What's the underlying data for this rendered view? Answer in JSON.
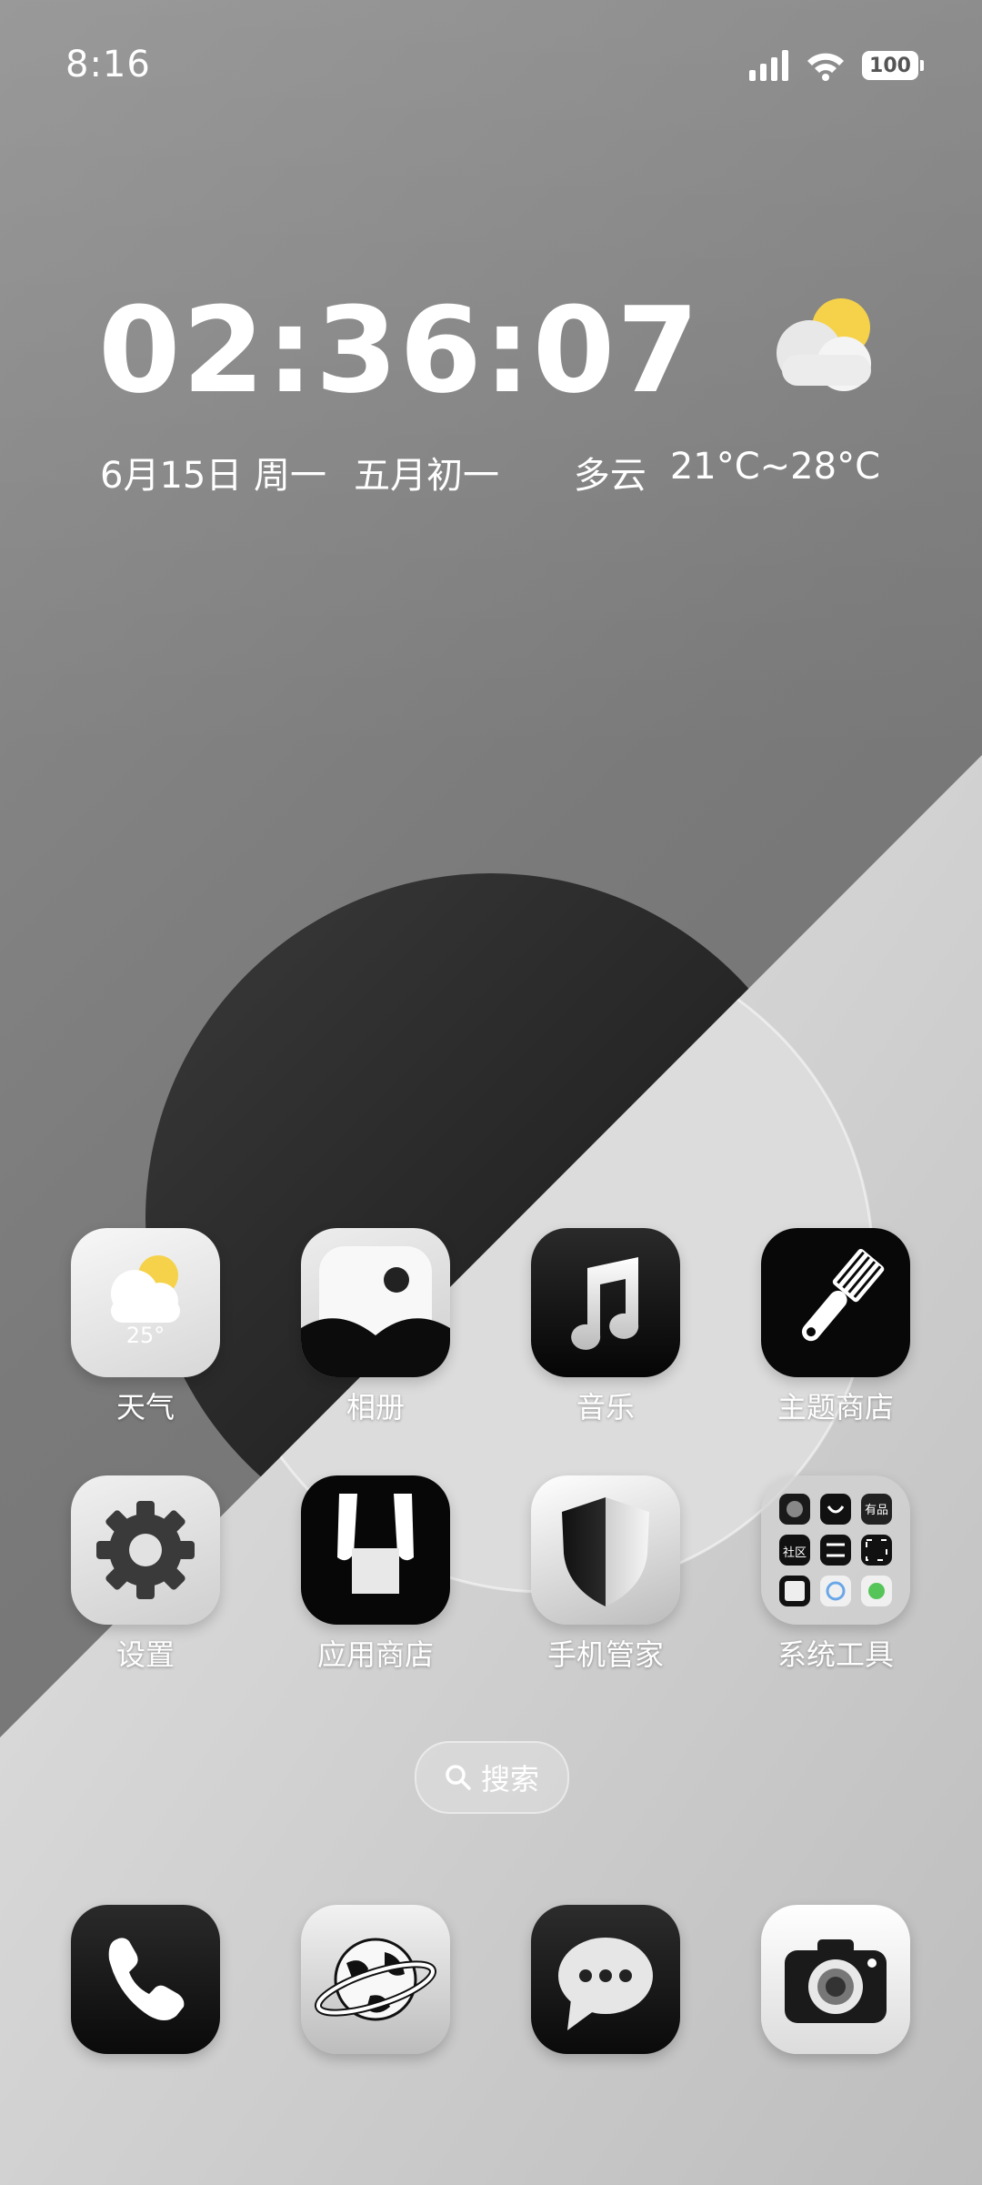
{
  "status_bar": {
    "time": "8:16",
    "battery": "100",
    "icons": [
      "signal-icon",
      "wifi-icon",
      "battery-icon"
    ]
  },
  "clock_widget": {
    "time": "02:36:07",
    "date": "6月15日 周一",
    "lunar": "五月初一",
    "weather_condition": "多云",
    "temperature_range": "21°C~28°C",
    "weather_icon": "partly-cloudy-icon"
  },
  "apps": [
    {
      "label": "天气",
      "icon": "weather-icon",
      "icon_text": "25°"
    },
    {
      "label": "相册",
      "icon": "gallery-icon"
    },
    {
      "label": "音乐",
      "icon": "music-icon"
    },
    {
      "label": "主题商店",
      "icon": "theme-store-icon"
    },
    {
      "label": "设置",
      "icon": "settings-icon"
    },
    {
      "label": "应用商店",
      "icon": "app-store-icon"
    },
    {
      "label": "手机管家",
      "icon": "security-icon"
    },
    {
      "label": "系统工具",
      "icon": "folder-icon",
      "folder_badge_1": "有品",
      "folder_badge_2": "社区"
    }
  ],
  "search": {
    "label": "搜索"
  },
  "dock": [
    {
      "icon": "phone-icon"
    },
    {
      "icon": "browser-icon"
    },
    {
      "icon": "messages-icon"
    },
    {
      "icon": "camera-icon"
    }
  ],
  "colors": {
    "accent_yellow": "#f5d24a",
    "icon_dark": "#111111",
    "icon_light": "#f2f2f2"
  }
}
